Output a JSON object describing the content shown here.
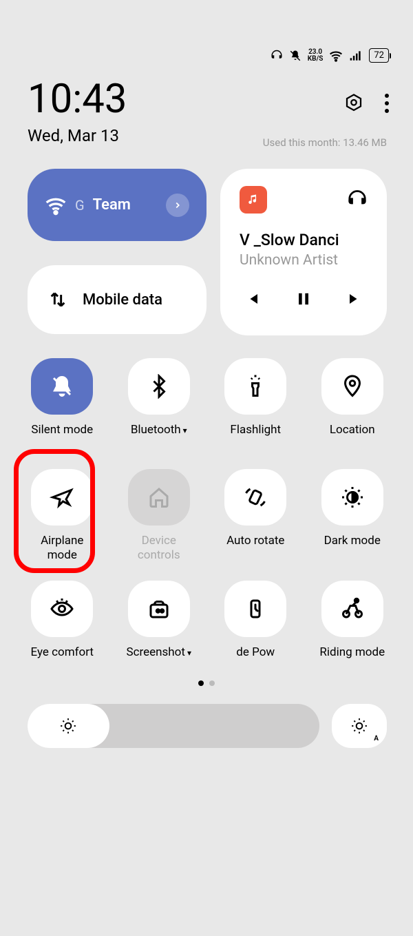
{
  "status": {
    "speed": "23.0",
    "speed_unit": "KB/S",
    "battery": "72"
  },
  "header": {
    "time": "10:43",
    "date": "Wed, Mar 13",
    "usage": "Used this month: 13.46 MB"
  },
  "wifi": {
    "prefix": "G",
    "name": "Team"
  },
  "mobile": {
    "label": "Mobile data"
  },
  "media": {
    "title": "V _Slow Danci",
    "artist": "Unknown Artist"
  },
  "tiles": [
    {
      "label": "Silent mode"
    },
    {
      "label": "Bluetooth"
    },
    {
      "label": "Flashlight"
    },
    {
      "label": "Location"
    },
    {
      "label": "Airplane mode"
    },
    {
      "label": "Device controls"
    },
    {
      "label": "Auto rotate"
    },
    {
      "label": "Dark mode"
    },
    {
      "label": "Eye comfort"
    },
    {
      "label": "Screenshot"
    },
    {
      "label_partial": "de    Pow"
    },
    {
      "label": "Riding mode"
    }
  ]
}
